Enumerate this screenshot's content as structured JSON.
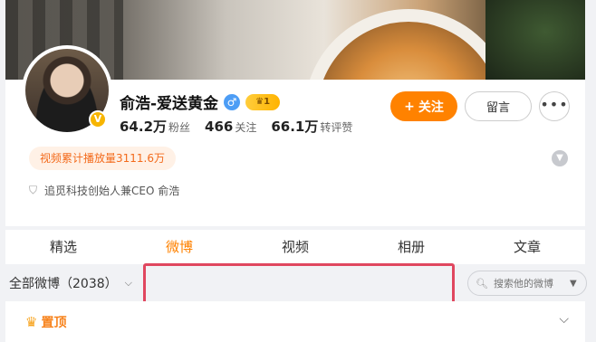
{
  "profile": {
    "name": "俞浩-爱送黄金",
    "vip_level": "1",
    "verified_mark": "V",
    "stats": [
      {
        "value": "64.2万",
        "label": "粉丝"
      },
      {
        "value": "466",
        "label": "关注"
      },
      {
        "value": "66.1万",
        "label": "转评赞"
      }
    ],
    "views_badge": "视频累计播放量3111.6万",
    "intro": "追觅科技创始人兼CEO 俞浩"
  },
  "actions": {
    "follow": "关注",
    "follow_icon": "+",
    "message": "留言",
    "more": "•••"
  },
  "tabs": [
    "精选",
    "微博",
    "视频",
    "相册",
    "文章"
  ],
  "active_tab": "微博",
  "filter": {
    "label": "全部微博（2038）",
    "search_placeholder": "搜索他的微博"
  },
  "pinned": {
    "label": "置顶"
  },
  "colors": {
    "accent": "#ff8200",
    "highlight": "#e0475f",
    "badge_text": "#f36a1b"
  }
}
